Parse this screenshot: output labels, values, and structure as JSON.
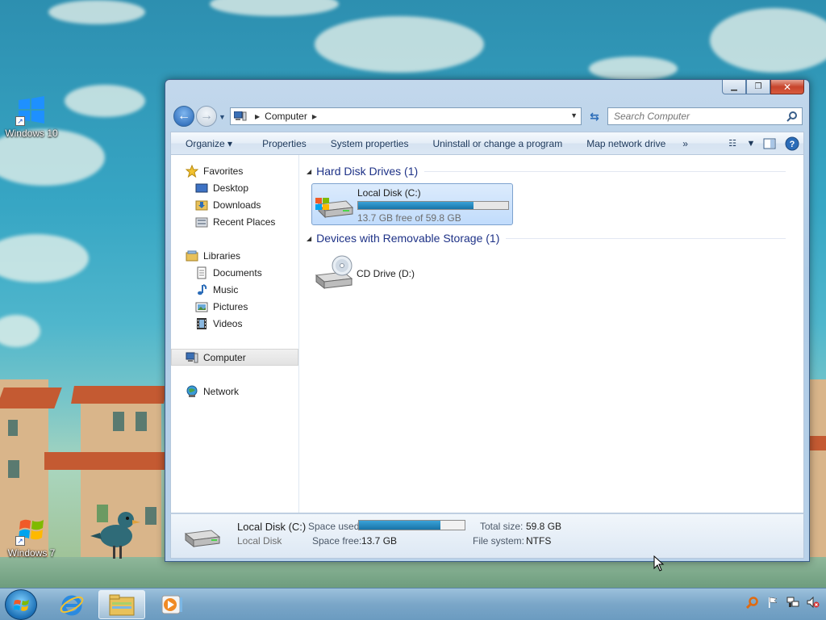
{
  "desktop": {
    "icons": [
      {
        "label": "Windows 10",
        "icon": "windows10-logo-icon"
      },
      {
        "label": "Windows 7",
        "icon": "windows7-logo-icon"
      }
    ]
  },
  "window": {
    "caption_buttons": {
      "minimize": "minimize-icon",
      "restore": "restore-icon",
      "close": "close-icon"
    },
    "address": {
      "segment": "Computer"
    },
    "search": {
      "placeholder": "Search Computer"
    },
    "toolbar": {
      "organize": "Organize",
      "properties": "Properties",
      "system_properties": "System properties",
      "uninstall": "Uninstall or change a program",
      "map_drive": "Map network drive",
      "more": "»"
    },
    "nav": {
      "favorites": "Favorites",
      "desktop": "Desktop",
      "downloads": "Downloads",
      "recent": "Recent Places",
      "libraries": "Libraries",
      "documents": "Documents",
      "music": "Music",
      "pictures": "Pictures",
      "videos": "Videos",
      "computer": "Computer",
      "network": "Network"
    },
    "groups": {
      "hdd": "Hard Disk Drives (1)",
      "removable": "Devices with Removable Storage (1)"
    },
    "drives": {
      "c": {
        "name": "Local Disk (C:)",
        "free_text": "13.7 GB free of 59.8 GB",
        "used_fraction": 0.77
      },
      "d": {
        "name": "CD Drive (D:)"
      }
    },
    "details": {
      "name": "Local Disk (C:)",
      "type": "Local Disk",
      "space_used_label": "Space used:",
      "space_free_label": "Space free:",
      "space_free": "13.7 GB",
      "total_size_label": "Total size:",
      "total_size": "59.8 GB",
      "file_system_label": "File system:",
      "file_system": "NTFS",
      "used_fraction": 0.77
    }
  },
  "colors": {
    "accent": "#1f5fb0",
    "bar_fill": "#1874a8",
    "group_header": "#1e3287"
  }
}
